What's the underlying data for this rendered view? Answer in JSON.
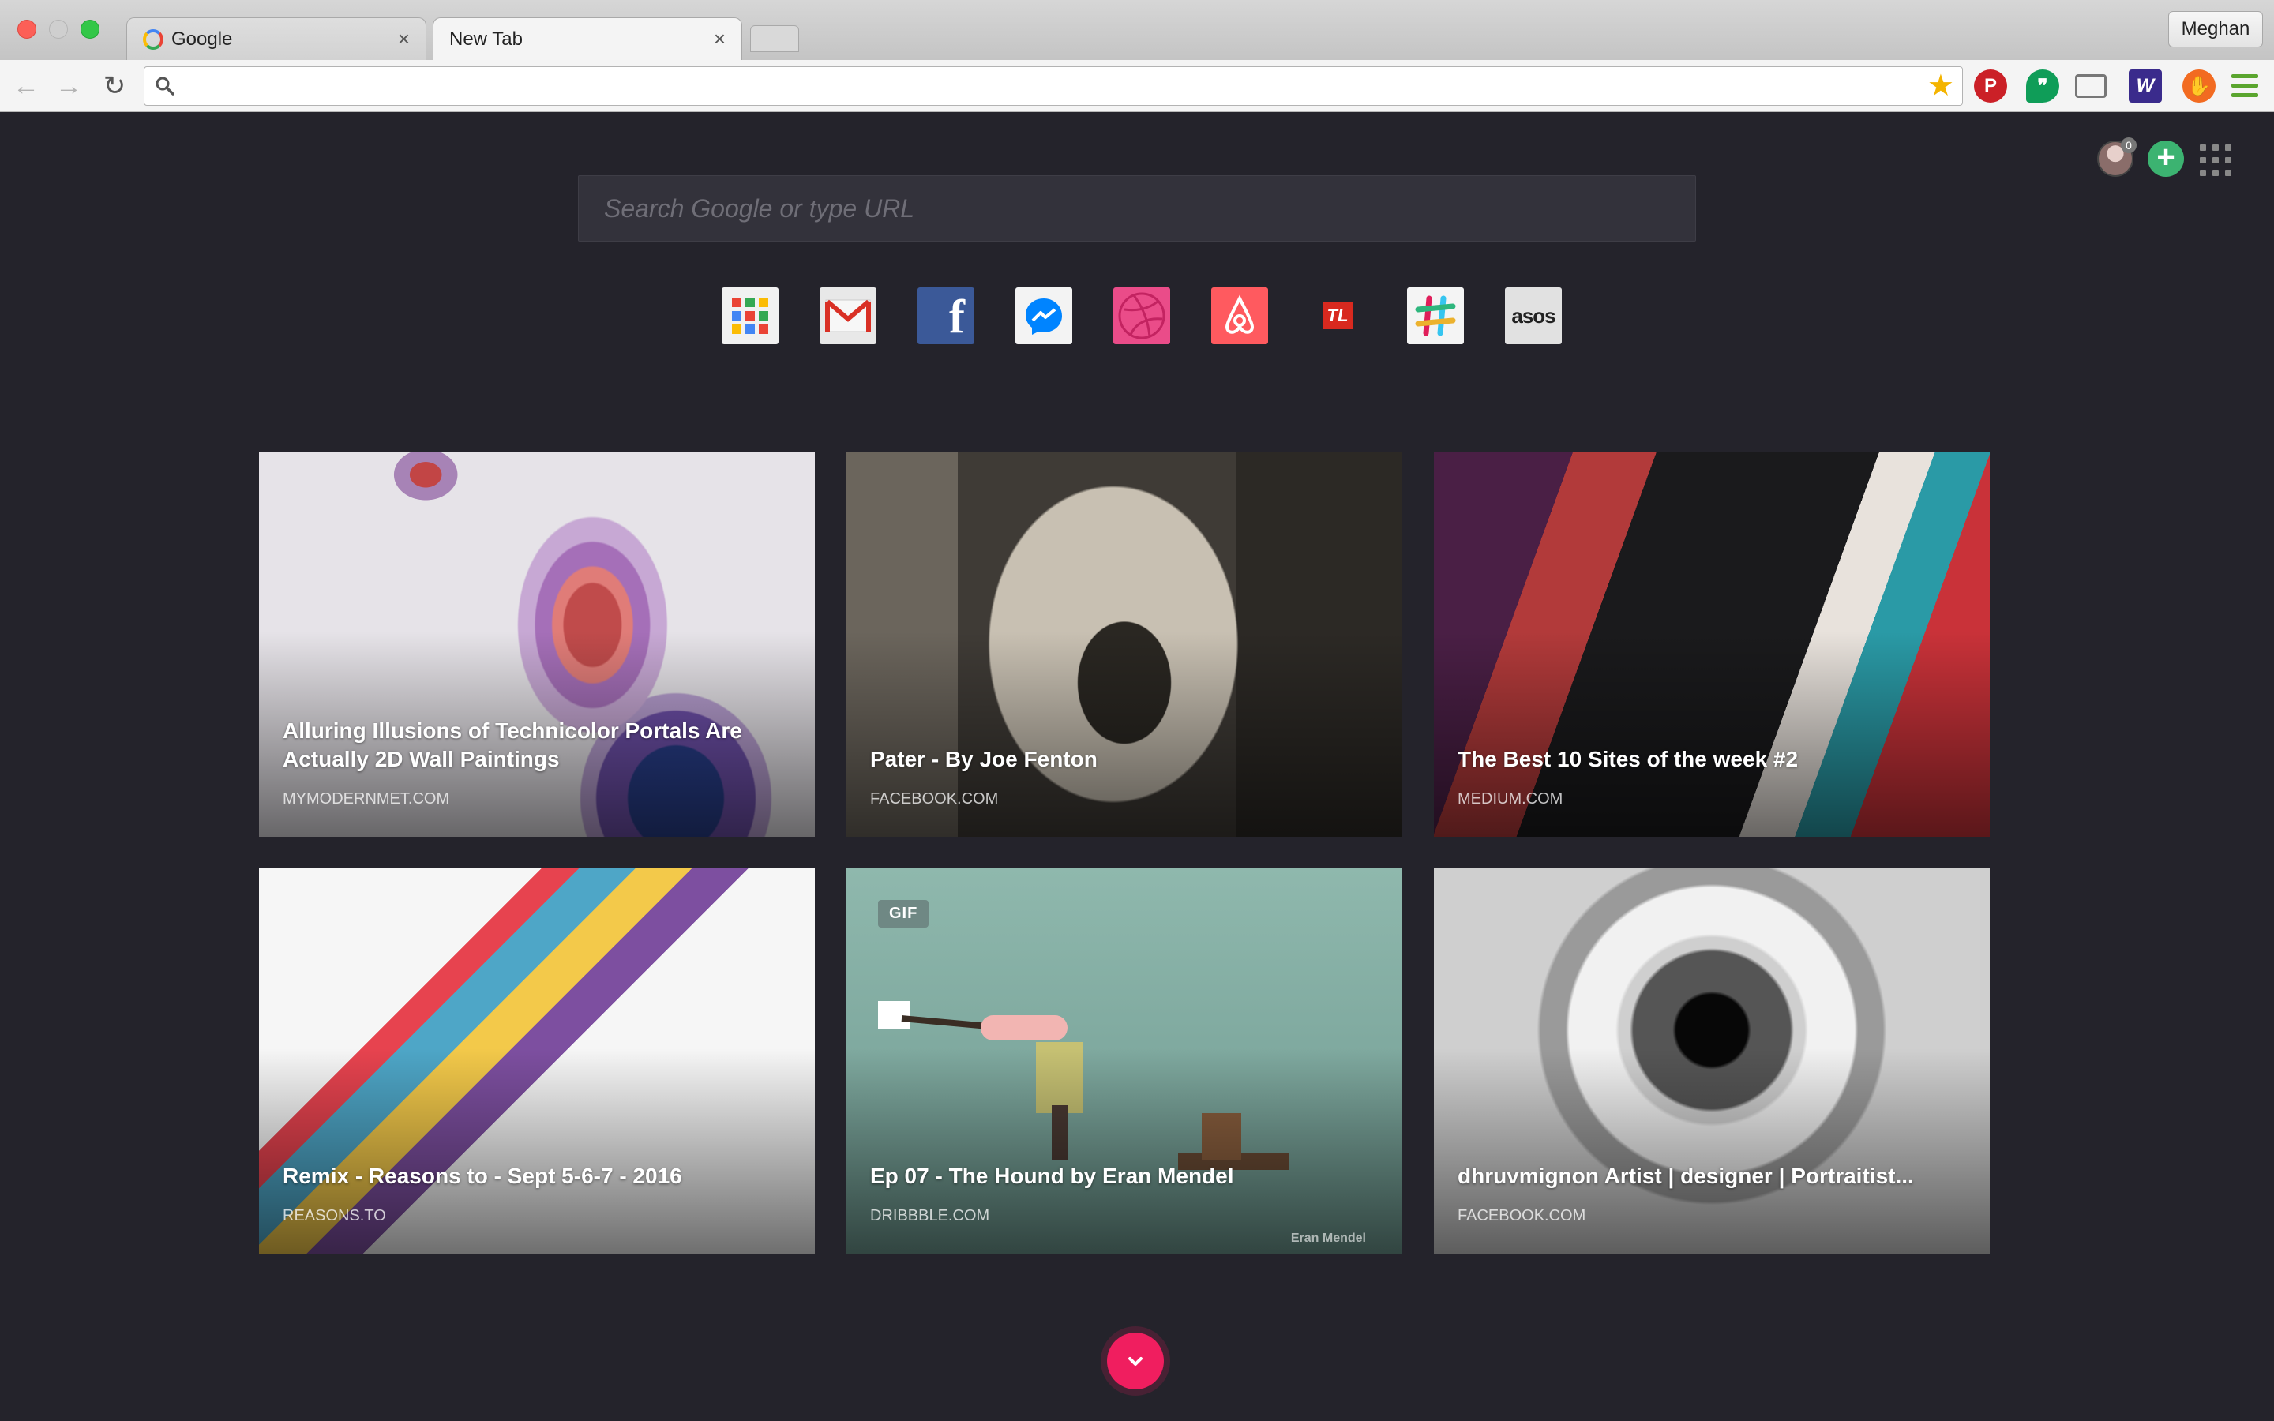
{
  "browser": {
    "tabs": [
      {
        "label": "Google",
        "favicon": "google-g-icon"
      },
      {
        "label": "New Tab"
      }
    ],
    "tab_close_glyph": "×",
    "profile_name": "Meghan",
    "omnibox": {
      "value": "",
      "placeholder": ""
    },
    "nav": {
      "back": "←",
      "forward": "→",
      "reload": "↻"
    },
    "bookmark_star": "★",
    "extensions": {
      "pinterest": "P",
      "hangouts": "❞",
      "w": "W",
      "hand": "✋"
    }
  },
  "page": {
    "search": {
      "placeholder": "Search Google or type URL",
      "value": ""
    },
    "notification_count": "0",
    "add_glyph": "+",
    "shortcuts": [
      {
        "name": "apps",
        "icon": "apps-grid-icon"
      },
      {
        "name": "gmail",
        "icon": "gmail-icon",
        "glyph": "M"
      },
      {
        "name": "facebook",
        "icon": "facebook-icon",
        "glyph": "f"
      },
      {
        "name": "messenger",
        "icon": "messenger-icon"
      },
      {
        "name": "dribbble",
        "icon": "dribbble-icon"
      },
      {
        "name": "airbnb",
        "icon": "airbnb-icon"
      },
      {
        "name": "tl",
        "icon": "tl-icon",
        "glyph": "TL"
      },
      {
        "name": "slack",
        "icon": "slack-icon",
        "glyph": "#"
      },
      {
        "name": "asos",
        "icon": "asos-icon",
        "glyph": "asos"
      }
    ],
    "cards": [
      {
        "title": "Alluring Illusions of Technicolor Portals Are Actually 2D Wall Paintings",
        "domain": "MYMODERNMET.COM"
      },
      {
        "title": "Pater - By Joe Fenton",
        "domain": "FACEBOOK.COM"
      },
      {
        "title": "The Best 10 Sites of the week #2",
        "domain": "MEDIUM.COM"
      },
      {
        "title": "Remix - Reasons to - Sept 5-6-7 - 2016",
        "domain": "REASONS.TO"
      },
      {
        "title": "Ep 07 - The Hound by Eran Mendel",
        "domain": "DRIBBBLE.COM",
        "badge": "GIF",
        "credit": "Eran Mendel"
      },
      {
        "title": "dhruvmignon Artist | designer | Portraitist...",
        "domain": "FACEBOOK.COM"
      }
    ]
  },
  "colors": {
    "page_bg": "#24232b",
    "search_bg": "#33323b",
    "fab": "#f01e5f",
    "add_button": "#3cb371"
  }
}
